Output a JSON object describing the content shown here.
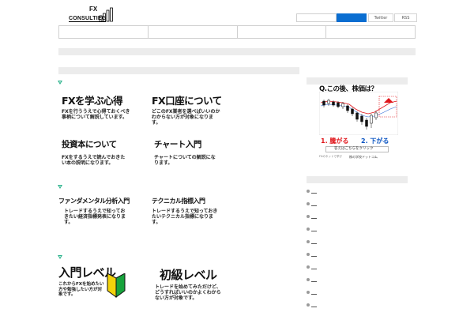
{
  "logo": {
    "fx": "FX",
    "name": "CONSULTIEG"
  },
  "header": {
    "search_placeholder": "",
    "twitter_label": "Twitter",
    "rss_label": "RSS"
  },
  "sections": [
    {
      "items": [
        {
          "title": "FXを学ぶ心得",
          "desc": "FXを行ううえで心得ておくべき事柄について解説しています。"
        },
        {
          "title": "FX口座について",
          "desc": "どこのFX業者を選べばいいのかわからない方が対象になります。"
        },
        {
          "title": "投資本について",
          "desc": "FXをするうえで読んでおきたい本の説明になります。"
        },
        {
          "title": "チャート入門",
          "desc": "チャートについての解説になります。"
        }
      ]
    },
    {
      "items": [
        {
          "title": "ファンダメンタル分析入門",
          "desc": "トレードするうえで知っておきたい経済指標発表になります。"
        },
        {
          "title": "テクニカル指標入門",
          "desc": "トレードするうえで知っておきたいテクニカル指標になります。"
        }
      ]
    },
    {
      "items": [
        {
          "title": "入門レベル",
          "desc": "これからFXを始めたい方や勉強したい方が対象です。"
        },
        {
          "title": "初級レベル",
          "desc": "トレードを始めてみただけど、どうすればいいのかよくわからない方が対象です。"
        }
      ]
    }
  ],
  "ad": {
    "question": "Q.この後、株価は？",
    "answer_up": "1. 騰がる",
    "answer_down": "2. 下がる",
    "answer_button": "答えはこちらをクリック",
    "sponsor_text": "FXのネットで学び",
    "brand": "株の学校ドットコム"
  },
  "colors": {
    "accent_blue": "#0a6ed1",
    "marker_green": "#2bb38c",
    "up_red": "#e0161b",
    "down_blue": "#0a54c2"
  },
  "sidebar": {
    "items": [
      "",
      "",
      "",
      "",
      "",
      "",
      "",
      "",
      "",
      ""
    ]
  }
}
